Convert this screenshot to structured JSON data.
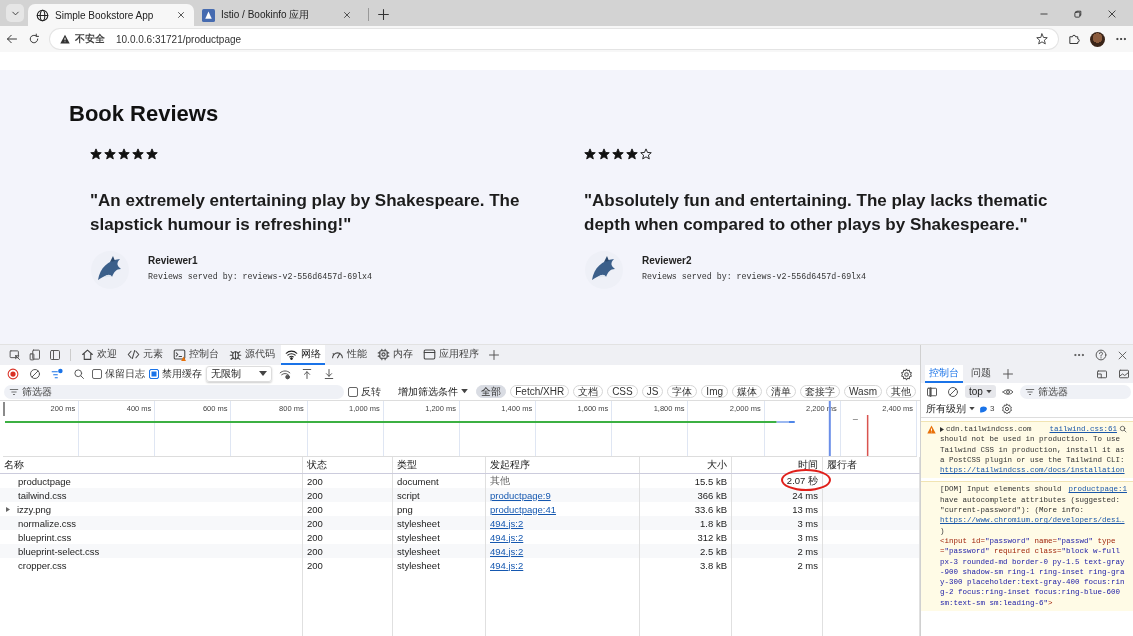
{
  "browser": {
    "tabs": [
      {
        "title": "Simple Bookstore App",
        "selected": true
      },
      {
        "title": "Istio / Bookinfo 应用",
        "selected": false
      }
    ],
    "security": "不安全",
    "url": "10.0.0.6:31721/productpage"
  },
  "page": {
    "heading": "Book Reviews",
    "reviews": [
      {
        "stars": 5,
        "quote": "\"An extremely entertaining play by Shakespeare. The slapstick humour is refreshing!\"",
        "reviewer": "Reviewer1",
        "served_by": "Reviews served by: reviews-v2-556d6457d-69lx4"
      },
      {
        "stars": 4,
        "quote": "\"Absolutely fun and entertaining. The play lacks thematic depth when compared to other plays by Shakespeare.\"",
        "reviewer": "Reviewer2",
        "served_by": "Reviews served by: reviews-v2-556d6457d-69lx4"
      }
    ]
  },
  "devtools": {
    "tabs": [
      {
        "label": "欢迎",
        "selected": false
      },
      {
        "label": "元素",
        "selected": false
      },
      {
        "label": "控制台",
        "selected": false
      },
      {
        "label": "源代码",
        "selected": false
      },
      {
        "label": "网络",
        "selected": true
      },
      {
        "label": "性能",
        "selected": false
      },
      {
        "label": "内存",
        "selected": false
      },
      {
        "label": "应用程序",
        "selected": false
      }
    ],
    "network": {
      "preserve_log": {
        "label": "保留日志",
        "checked": false
      },
      "disable_cache": {
        "label": "禁用缓存",
        "checked": true
      },
      "throttling": "无限制",
      "filter": {
        "placeholder": "筛选器"
      },
      "invert": {
        "label": "反转",
        "checked": false
      },
      "more_filters": "增加筛选条件",
      "type_filters": [
        {
          "label": "全部",
          "selected": true
        },
        {
          "label": "Fetch/XHR",
          "selected": false
        },
        {
          "label": "文档",
          "selected": false
        },
        {
          "label": "CSS",
          "selected": false
        },
        {
          "label": "JS",
          "selected": false
        },
        {
          "label": "字体",
          "selected": false
        },
        {
          "label": "Img",
          "selected": false
        },
        {
          "label": "媒体",
          "selected": false
        },
        {
          "label": "清单",
          "selected": false
        },
        {
          "label": "套接字",
          "selected": false
        },
        {
          "label": "Wasm",
          "selected": false
        },
        {
          "label": "其他",
          "selected": false
        }
      ],
      "timeline_ticks": [
        "200 ms",
        "400 ms",
        "600 ms",
        "800 ms",
        "1,000 ms",
        "1,200 ms",
        "1,400 ms",
        "1,600 ms",
        "1,800 ms",
        "2,000 ms",
        "2,200 ms",
        "2,400 ms"
      ],
      "columns": [
        "名称",
        "状态",
        "类型",
        "发起程序",
        "大小",
        "时间",
        "履行者"
      ],
      "rows": [
        {
          "name": "productpage",
          "status": "200",
          "type": "document",
          "initiator": "其他",
          "initiator_link": false,
          "size": "15.5 kB",
          "time": "2.07 秒",
          "expandable": false,
          "circled": true
        },
        {
          "name": "tailwind.css",
          "status": "200",
          "type": "script",
          "initiator": "productpage:9",
          "initiator_link": true,
          "size": "366 kB",
          "time": "24 ms",
          "expandable": false,
          "circled": false
        },
        {
          "name": "izzy.png",
          "status": "200",
          "type": "png",
          "initiator": "productpage:41",
          "initiator_link": true,
          "size": "33.6 kB",
          "time": "13 ms",
          "expandable": true,
          "circled": false
        },
        {
          "name": "normalize.css",
          "status": "200",
          "type": "stylesheet",
          "initiator": "494.js:2",
          "initiator_link": true,
          "size": "1.8 kB",
          "time": "3 ms",
          "expandable": false,
          "circled": false
        },
        {
          "name": "blueprint.css",
          "status": "200",
          "type": "stylesheet",
          "initiator": "494.js:2",
          "initiator_link": true,
          "size": "312 kB",
          "time": "3 ms",
          "expandable": false,
          "circled": false
        },
        {
          "name": "blueprint-select.css",
          "status": "200",
          "type": "stylesheet",
          "initiator": "494.js:2",
          "initiator_link": true,
          "size": "2.5 kB",
          "time": "2 ms",
          "expandable": false,
          "circled": false
        },
        {
          "name": "cropper.css",
          "status": "200",
          "type": "stylesheet",
          "initiator": "494.js:2",
          "initiator_link": true,
          "size": "3.8 kB",
          "time": "2 ms",
          "expandable": false,
          "circled": false
        }
      ]
    },
    "console": {
      "tabs": [
        {
          "label": "控制台",
          "selected": true
        },
        {
          "label": "问题",
          "selected": false
        }
      ],
      "context": "top",
      "filter": {
        "placeholder": "筛选器"
      },
      "levels": "所有级别",
      "issue_count": "3",
      "messages": [
        {
          "kind": "warning",
          "source": "cdn.tailwindcss.com",
          "location": "tailwind.css:61",
          "text": "should not be used in production. To use Tailwind CSS in production, install it as a PostCSS plugin or use the Tailwind CLI:",
          "url": "https://tailwindcss.com/docs/installation"
        },
        {
          "kind": "issue",
          "source": "[DOM] Input elements should",
          "location": "productpage:1",
          "text": "have autocomplete attributes (suggested: \"current-password\"): (More info:",
          "url": "https://www.chromium.org/developers/desi…",
          "closing": ")",
          "code": [
            {
              "kind": "tag",
              "text": "<input"
            },
            {
              "kind": "attr",
              "text": " id="
            },
            {
              "kind": "value",
              "text": "\"password\""
            },
            {
              "kind": "attr",
              "text": " name="
            },
            {
              "kind": "value",
              "text": "\"passwd\""
            },
            {
              "kind": "attr",
              "text": " type="
            },
            {
              "kind": "value",
              "text": "\"password\""
            },
            {
              "kind": "attr",
              "text": " required class="
            },
            {
              "kind": "value",
              "text": "\"block w-full px-3 rounded-md border-0 py-1.5 text-gray-900 shadow-sm ring-1 ring-inset ring-gray-300 placeholder:text-gray-400 focus:ring-2 focus:ring-inset focus:ring-blue-600 sm:text-sm sm:leading-6\""
            },
            {
              "kind": "tag",
              "text": ">"
            }
          ]
        }
      ]
    }
  }
}
